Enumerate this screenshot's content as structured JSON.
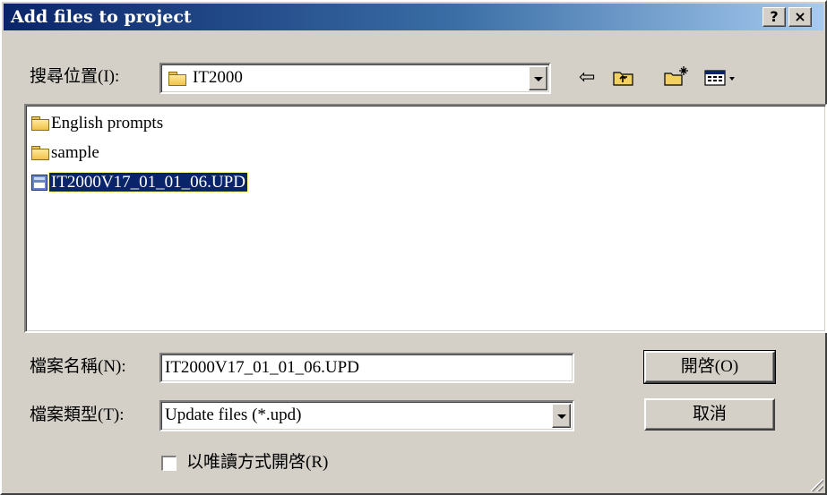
{
  "window": {
    "title": "Add files to project",
    "help_glyph": "?",
    "close_glyph": "×"
  },
  "look_in": {
    "label": "搜尋位置(I):",
    "value": "IT2000",
    "icon": "folder-icon"
  },
  "toolbar": {
    "back_glyph": "⇦",
    "up_icon": "up-folder-icon",
    "new_icon": "new-folder-icon",
    "views_icon": "views-menu-icon"
  },
  "file_list": {
    "items": [
      {
        "label": "English prompts",
        "type": "folder",
        "selected": false
      },
      {
        "label": "sample",
        "type": "folder",
        "selected": false
      },
      {
        "label": "IT2000V17_01_01_06.UPD",
        "type": "file",
        "selected": true
      }
    ]
  },
  "file_name": {
    "label": "檔案名稱(N):",
    "value": "IT2000V17_01_01_06.UPD"
  },
  "file_type": {
    "label": "檔案類型(T):",
    "value": "Update files (*.upd)"
  },
  "readonly": {
    "label": "以唯讀方式開啓(R)",
    "checked": false
  },
  "buttons": {
    "open": "開啓(O)",
    "cancel": "取消"
  }
}
